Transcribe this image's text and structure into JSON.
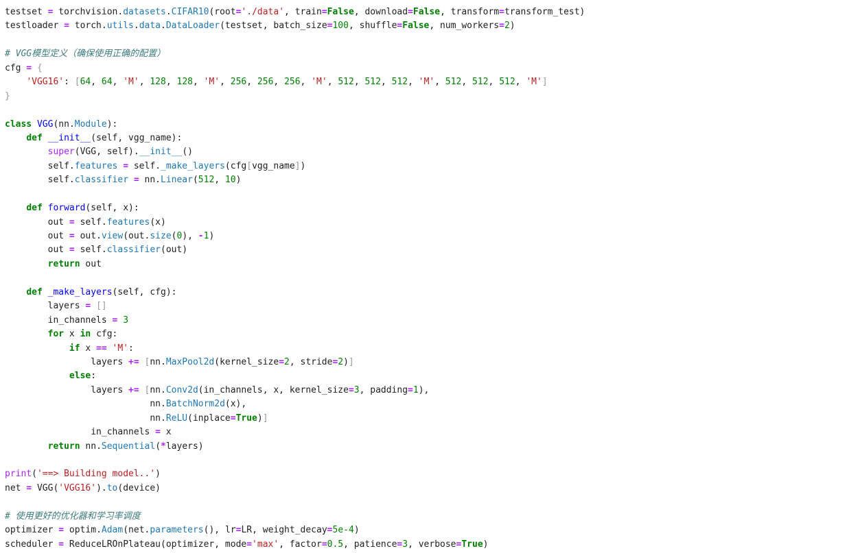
{
  "colors": {
    "background": "#ffffff",
    "text": "#212121",
    "keyword": "#008000",
    "string": "#ba2121",
    "number": "#008000",
    "comment": "#3d7b7b",
    "operator": "#aa22ff",
    "function": "#0000ff",
    "attribute": "#1f77b4"
  },
  "code": {
    "lines": [
      [
        {
          "t": "testset ",
          "k": "plain"
        },
        {
          "t": "=",
          "k": "op"
        },
        {
          "t": " torchvision",
          "k": "plain"
        },
        {
          "t": ".",
          "k": "plain"
        },
        {
          "t": "datasets",
          "k": "attr"
        },
        {
          "t": ".",
          "k": "plain"
        },
        {
          "t": "CIFAR10",
          "k": "attr"
        },
        {
          "t": "(root",
          "k": "plain"
        },
        {
          "t": "=",
          "k": "op"
        },
        {
          "t": "'./data'",
          "k": "str"
        },
        {
          "t": ", train",
          "k": "plain"
        },
        {
          "t": "=",
          "k": "op"
        },
        {
          "t": "False",
          "k": "kc"
        },
        {
          "t": ", download",
          "k": "plain"
        },
        {
          "t": "=",
          "k": "op"
        },
        {
          "t": "False",
          "k": "kc"
        },
        {
          "t": ", transform",
          "k": "plain"
        },
        {
          "t": "=",
          "k": "op"
        },
        {
          "t": "transform_test)",
          "k": "plain"
        }
      ],
      [
        {
          "t": "testloader ",
          "k": "plain"
        },
        {
          "t": "=",
          "k": "op"
        },
        {
          "t": " torch",
          "k": "plain"
        },
        {
          "t": ".",
          "k": "plain"
        },
        {
          "t": "utils",
          "k": "attr"
        },
        {
          "t": ".",
          "k": "plain"
        },
        {
          "t": "data",
          "k": "attr"
        },
        {
          "t": ".",
          "k": "plain"
        },
        {
          "t": "DataLoader",
          "k": "attr"
        },
        {
          "t": "(testset, batch_size",
          "k": "plain"
        },
        {
          "t": "=",
          "k": "op"
        },
        {
          "t": "100",
          "k": "num"
        },
        {
          "t": ", shuffle",
          "k": "plain"
        },
        {
          "t": "=",
          "k": "op"
        },
        {
          "t": "False",
          "k": "kc"
        },
        {
          "t": ", num_workers",
          "k": "plain"
        },
        {
          "t": "=",
          "k": "op"
        },
        {
          "t": "2",
          "k": "num"
        },
        {
          "t": ")",
          "k": "plain"
        }
      ],
      [],
      [
        {
          "t": "# VGG模型定义（确保使用正确的配置）",
          "k": "com"
        }
      ],
      [
        {
          "t": "cfg ",
          "k": "plain"
        },
        {
          "t": "=",
          "k": "op"
        },
        {
          "t": " ",
          "k": "plain"
        },
        {
          "t": "{",
          "k": "brk"
        }
      ],
      [
        {
          "t": "    ",
          "k": "plain"
        },
        {
          "t": "'VGG16'",
          "k": "str"
        },
        {
          "t": ": ",
          "k": "plain"
        },
        {
          "t": "[",
          "k": "brk"
        },
        {
          "t": "64",
          "k": "num"
        },
        {
          "t": ", ",
          "k": "plain"
        },
        {
          "t": "64",
          "k": "num"
        },
        {
          "t": ", ",
          "k": "plain"
        },
        {
          "t": "'M'",
          "k": "str"
        },
        {
          "t": ", ",
          "k": "plain"
        },
        {
          "t": "128",
          "k": "num"
        },
        {
          "t": ", ",
          "k": "plain"
        },
        {
          "t": "128",
          "k": "num"
        },
        {
          "t": ", ",
          "k": "plain"
        },
        {
          "t": "'M'",
          "k": "str"
        },
        {
          "t": ", ",
          "k": "plain"
        },
        {
          "t": "256",
          "k": "num"
        },
        {
          "t": ", ",
          "k": "plain"
        },
        {
          "t": "256",
          "k": "num"
        },
        {
          "t": ", ",
          "k": "plain"
        },
        {
          "t": "256",
          "k": "num"
        },
        {
          "t": ", ",
          "k": "plain"
        },
        {
          "t": "'M'",
          "k": "str"
        },
        {
          "t": ", ",
          "k": "plain"
        },
        {
          "t": "512",
          "k": "num"
        },
        {
          "t": ", ",
          "k": "plain"
        },
        {
          "t": "512",
          "k": "num"
        },
        {
          "t": ", ",
          "k": "plain"
        },
        {
          "t": "512",
          "k": "num"
        },
        {
          "t": ", ",
          "k": "plain"
        },
        {
          "t": "'M'",
          "k": "str"
        },
        {
          "t": ", ",
          "k": "plain"
        },
        {
          "t": "512",
          "k": "num"
        },
        {
          "t": ", ",
          "k": "plain"
        },
        {
          "t": "512",
          "k": "num"
        },
        {
          "t": ", ",
          "k": "plain"
        },
        {
          "t": "512",
          "k": "num"
        },
        {
          "t": ", ",
          "k": "plain"
        },
        {
          "t": "'M'",
          "k": "str"
        },
        {
          "t": "]",
          "k": "brk"
        }
      ],
      [
        {
          "t": "}",
          "k": "brk"
        }
      ],
      [],
      [
        {
          "t": "class",
          "k": "kw"
        },
        {
          "t": " ",
          "k": "plain"
        },
        {
          "t": "VGG",
          "k": "cls"
        },
        {
          "t": "(nn",
          "k": "plain"
        },
        {
          "t": ".",
          "k": "plain"
        },
        {
          "t": "Module",
          "k": "attr"
        },
        {
          "t": "):",
          "k": "plain"
        }
      ],
      [
        {
          "t": "    ",
          "k": "plain"
        },
        {
          "t": "def",
          "k": "kw"
        },
        {
          "t": " ",
          "k": "plain"
        },
        {
          "t": "__init__",
          "k": "fn"
        },
        {
          "t": "(self, vgg_name):",
          "k": "plain"
        }
      ],
      [
        {
          "t": "        ",
          "k": "plain"
        },
        {
          "t": "super",
          "k": "bi"
        },
        {
          "t": "(VGG, self)",
          "k": "plain"
        },
        {
          "t": ".",
          "k": "plain"
        },
        {
          "t": "__init__",
          "k": "attr"
        },
        {
          "t": "()",
          "k": "plain"
        }
      ],
      [
        {
          "t": "        self",
          "k": "plain"
        },
        {
          "t": ".",
          "k": "plain"
        },
        {
          "t": "features",
          "k": "attr"
        },
        {
          "t": " ",
          "k": "plain"
        },
        {
          "t": "=",
          "k": "op"
        },
        {
          "t": " self",
          "k": "plain"
        },
        {
          "t": ".",
          "k": "plain"
        },
        {
          "t": "_make_layers",
          "k": "attr"
        },
        {
          "t": "(cfg",
          "k": "plain"
        },
        {
          "t": "[",
          "k": "brk"
        },
        {
          "t": "vgg_name",
          "k": "plain"
        },
        {
          "t": "]",
          "k": "brk"
        },
        {
          "t": ")",
          "k": "plain"
        }
      ],
      [
        {
          "t": "        self",
          "k": "plain"
        },
        {
          "t": ".",
          "k": "plain"
        },
        {
          "t": "classifier",
          "k": "attr"
        },
        {
          "t": " ",
          "k": "plain"
        },
        {
          "t": "=",
          "k": "op"
        },
        {
          "t": " nn",
          "k": "plain"
        },
        {
          "t": ".",
          "k": "plain"
        },
        {
          "t": "Linear",
          "k": "attr"
        },
        {
          "t": "(",
          "k": "plain"
        },
        {
          "t": "512",
          "k": "num"
        },
        {
          "t": ", ",
          "k": "plain"
        },
        {
          "t": "10",
          "k": "num"
        },
        {
          "t": ")",
          "k": "plain"
        }
      ],
      [],
      [
        {
          "t": "    ",
          "k": "plain"
        },
        {
          "t": "def",
          "k": "kw"
        },
        {
          "t": " ",
          "k": "plain"
        },
        {
          "t": "forward",
          "k": "fn"
        },
        {
          "t": "(self, x):",
          "k": "plain"
        }
      ],
      [
        {
          "t": "        out ",
          "k": "plain"
        },
        {
          "t": "=",
          "k": "op"
        },
        {
          "t": " self",
          "k": "plain"
        },
        {
          "t": ".",
          "k": "plain"
        },
        {
          "t": "features",
          "k": "attr"
        },
        {
          "t": "(x)",
          "k": "plain"
        }
      ],
      [
        {
          "t": "        out ",
          "k": "plain"
        },
        {
          "t": "=",
          "k": "op"
        },
        {
          "t": " out",
          "k": "plain"
        },
        {
          "t": ".",
          "k": "plain"
        },
        {
          "t": "view",
          "k": "attr"
        },
        {
          "t": "(out",
          "k": "plain"
        },
        {
          "t": ".",
          "k": "plain"
        },
        {
          "t": "size",
          "k": "attr"
        },
        {
          "t": "(",
          "k": "plain"
        },
        {
          "t": "0",
          "k": "num"
        },
        {
          "t": "), ",
          "k": "plain"
        },
        {
          "t": "-",
          "k": "op"
        },
        {
          "t": "1",
          "k": "num"
        },
        {
          "t": ")",
          "k": "plain"
        }
      ],
      [
        {
          "t": "        out ",
          "k": "plain"
        },
        {
          "t": "=",
          "k": "op"
        },
        {
          "t": " self",
          "k": "plain"
        },
        {
          "t": ".",
          "k": "plain"
        },
        {
          "t": "classifier",
          "k": "attr"
        },
        {
          "t": "(out)",
          "k": "plain"
        }
      ],
      [
        {
          "t": "        ",
          "k": "plain"
        },
        {
          "t": "return",
          "k": "kw"
        },
        {
          "t": " out",
          "k": "plain"
        }
      ],
      [],
      [
        {
          "t": "    ",
          "k": "plain"
        },
        {
          "t": "def",
          "k": "kw"
        },
        {
          "t": " ",
          "k": "plain"
        },
        {
          "t": "_make_layers",
          "k": "fn"
        },
        {
          "t": "(self, cfg):",
          "k": "plain"
        }
      ],
      [
        {
          "t": "        layers ",
          "k": "plain"
        },
        {
          "t": "=",
          "k": "op"
        },
        {
          "t": " ",
          "k": "plain"
        },
        {
          "t": "[]",
          "k": "brk"
        }
      ],
      [
        {
          "t": "        in_channels ",
          "k": "plain"
        },
        {
          "t": "=",
          "k": "op"
        },
        {
          "t": " ",
          "k": "plain"
        },
        {
          "t": "3",
          "k": "num"
        }
      ],
      [
        {
          "t": "        ",
          "k": "plain"
        },
        {
          "t": "for",
          "k": "kw"
        },
        {
          "t": " x ",
          "k": "plain"
        },
        {
          "t": "in",
          "k": "kw"
        },
        {
          "t": " cfg:",
          "k": "plain"
        }
      ],
      [
        {
          "t": "            ",
          "k": "plain"
        },
        {
          "t": "if",
          "k": "kw"
        },
        {
          "t": " x ",
          "k": "plain"
        },
        {
          "t": "==",
          "k": "op"
        },
        {
          "t": " ",
          "k": "plain"
        },
        {
          "t": "'M'",
          "k": "str"
        },
        {
          "t": ":",
          "k": "plain"
        }
      ],
      [
        {
          "t": "                layers ",
          "k": "plain"
        },
        {
          "t": "+=",
          "k": "op"
        },
        {
          "t": " ",
          "k": "plain"
        },
        {
          "t": "[",
          "k": "brk"
        },
        {
          "t": "nn",
          "k": "plain"
        },
        {
          "t": ".",
          "k": "plain"
        },
        {
          "t": "MaxPool2d",
          "k": "attr"
        },
        {
          "t": "(kernel_size",
          "k": "plain"
        },
        {
          "t": "=",
          "k": "op"
        },
        {
          "t": "2",
          "k": "num"
        },
        {
          "t": ", stride",
          "k": "plain"
        },
        {
          "t": "=",
          "k": "op"
        },
        {
          "t": "2",
          "k": "num"
        },
        {
          "t": ")",
          "k": "plain"
        },
        {
          "t": "]",
          "k": "brk"
        }
      ],
      [
        {
          "t": "            ",
          "k": "plain"
        },
        {
          "t": "else",
          "k": "kw"
        },
        {
          "t": ":",
          "k": "plain"
        }
      ],
      [
        {
          "t": "                layers ",
          "k": "plain"
        },
        {
          "t": "+=",
          "k": "op"
        },
        {
          "t": " ",
          "k": "plain"
        },
        {
          "t": "[",
          "k": "brk"
        },
        {
          "t": "nn",
          "k": "plain"
        },
        {
          "t": ".",
          "k": "plain"
        },
        {
          "t": "Conv2d",
          "k": "attr"
        },
        {
          "t": "(in_channels, x, kernel_size",
          "k": "plain"
        },
        {
          "t": "=",
          "k": "op"
        },
        {
          "t": "3",
          "k": "num"
        },
        {
          "t": ", padding",
          "k": "plain"
        },
        {
          "t": "=",
          "k": "op"
        },
        {
          "t": "1",
          "k": "num"
        },
        {
          "t": "),",
          "k": "plain"
        }
      ],
      [
        {
          "t": "                           nn",
          "k": "plain"
        },
        {
          "t": ".",
          "k": "plain"
        },
        {
          "t": "BatchNorm2d",
          "k": "attr"
        },
        {
          "t": "(x),",
          "k": "plain"
        }
      ],
      [
        {
          "t": "                           nn",
          "k": "plain"
        },
        {
          "t": ".",
          "k": "plain"
        },
        {
          "t": "ReLU",
          "k": "attr"
        },
        {
          "t": "(inplace",
          "k": "plain"
        },
        {
          "t": "=",
          "k": "op"
        },
        {
          "t": "True",
          "k": "kc"
        },
        {
          "t": ")",
          "k": "plain"
        },
        {
          "t": "]",
          "k": "brk"
        }
      ],
      [
        {
          "t": "                in_channels ",
          "k": "plain"
        },
        {
          "t": "=",
          "k": "op"
        },
        {
          "t": " x",
          "k": "plain"
        }
      ],
      [
        {
          "t": "        ",
          "k": "plain"
        },
        {
          "t": "return",
          "k": "kw"
        },
        {
          "t": " nn",
          "k": "plain"
        },
        {
          "t": ".",
          "k": "plain"
        },
        {
          "t": "Sequential",
          "k": "attr"
        },
        {
          "t": "(",
          "k": "plain"
        },
        {
          "t": "*",
          "k": "op"
        },
        {
          "t": "layers)",
          "k": "plain"
        }
      ],
      [],
      [
        {
          "t": "print",
          "k": "bi"
        },
        {
          "t": "(",
          "k": "plain"
        },
        {
          "t": "'==> Building model..'",
          "k": "str"
        },
        {
          "t": ")",
          "k": "plain"
        }
      ],
      [
        {
          "t": "net ",
          "k": "plain"
        },
        {
          "t": "=",
          "k": "op"
        },
        {
          "t": " VGG(",
          "k": "plain"
        },
        {
          "t": "'VGG16'",
          "k": "str"
        },
        {
          "t": ")",
          "k": "plain"
        },
        {
          "t": ".",
          "k": "plain"
        },
        {
          "t": "to",
          "k": "attr"
        },
        {
          "t": "(device)",
          "k": "plain"
        }
      ],
      [],
      [
        {
          "t": "# 使用更好的优化器和学习率调度",
          "k": "com"
        }
      ],
      [
        {
          "t": "optimizer ",
          "k": "plain"
        },
        {
          "t": "=",
          "k": "op"
        },
        {
          "t": " optim",
          "k": "plain"
        },
        {
          "t": ".",
          "k": "plain"
        },
        {
          "t": "Adam",
          "k": "attr"
        },
        {
          "t": "(net",
          "k": "plain"
        },
        {
          "t": ".",
          "k": "plain"
        },
        {
          "t": "parameters",
          "k": "attr"
        },
        {
          "t": "(), lr",
          "k": "plain"
        },
        {
          "t": "=",
          "k": "op"
        },
        {
          "t": "LR, weight_decay",
          "k": "plain"
        },
        {
          "t": "=",
          "k": "op"
        },
        {
          "t": "5e-4",
          "k": "num"
        },
        {
          "t": ")",
          "k": "plain"
        }
      ],
      [
        {
          "t": "scheduler ",
          "k": "plain"
        },
        {
          "t": "=",
          "k": "op"
        },
        {
          "t": " ReduceLROnPlateau(optimizer, mode",
          "k": "plain"
        },
        {
          "t": "=",
          "k": "op"
        },
        {
          "t": "'max'",
          "k": "str"
        },
        {
          "t": ", factor",
          "k": "plain"
        },
        {
          "t": "=",
          "k": "op"
        },
        {
          "t": "0.5",
          "k": "num"
        },
        {
          "t": ", patience",
          "k": "plain"
        },
        {
          "t": "=",
          "k": "op"
        },
        {
          "t": "3",
          "k": "num"
        },
        {
          "t": ", verbose",
          "k": "plain"
        },
        {
          "t": "=",
          "k": "op"
        },
        {
          "t": "True",
          "k": "kc"
        },
        {
          "t": ")",
          "k": "plain"
        }
      ]
    ]
  }
}
